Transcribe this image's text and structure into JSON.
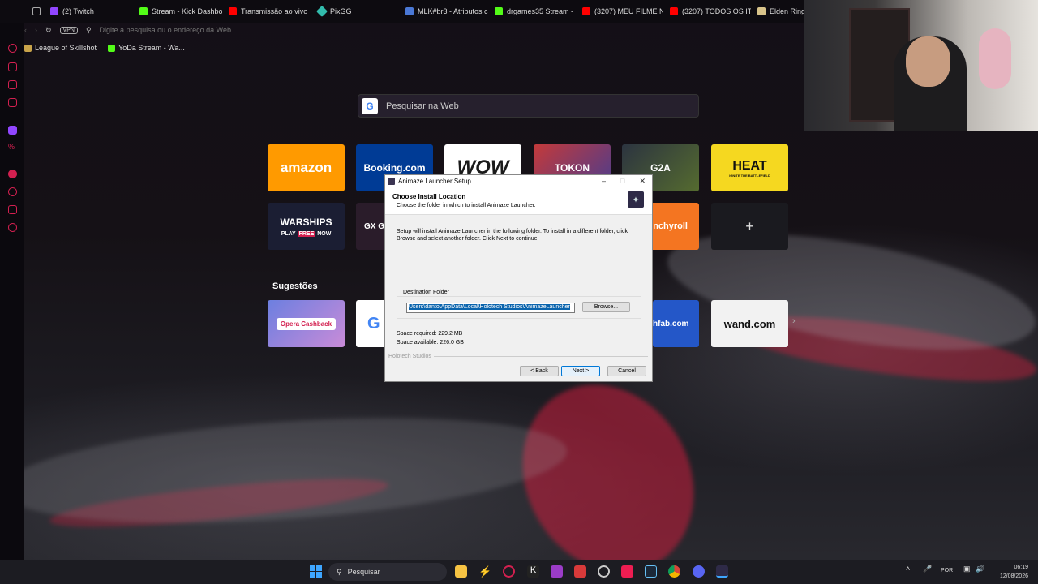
{
  "browser": {
    "tabs": [
      {
        "label": "(2) Twitch",
        "color": "#9146ff"
      },
      {
        "label": "Stream - Kick Dashbo",
        "color": "#53fc18"
      },
      {
        "label": "Transmissão ao vivo",
        "color": "#ff0000"
      },
      {
        "label": "PixGG",
        "color": "#32bcad"
      },
      {
        "label": "MLK#br3 - Atributos c",
        "color": "#4a78d6"
      },
      {
        "label": "drgames35 Stream - ",
        "color": "#53fc18"
      },
      {
        "label": "(3207) MEU FILME N",
        "color": "#ff0000"
      },
      {
        "label": "(3207) TODOS OS IT",
        "color": "#ff0000"
      },
      {
        "label": "Elden Ring M",
        "color": "#d8c38a"
      }
    ],
    "vpn_label": "VPN",
    "address_placeholder": "Digite a pesquisa ou o endereço da Web",
    "bookmarks": [
      {
        "label": "League of Skillshot"
      },
      {
        "label": "YoDa Stream - Wa..."
      }
    ],
    "accent_color": "#d32050"
  },
  "start_page": {
    "search_placeholder": "Pesquisar na Web",
    "speed_dials": [
      {
        "label": "amazon",
        "bg": "#ff9a00",
        "fg": "#ffffff"
      },
      {
        "label": "Booking.com",
        "bg": "#003b95",
        "fg": "#ffffff"
      },
      {
        "label": "WOW",
        "bg": "#ffffff",
        "fg": "#1a1a1a"
      },
      {
        "label": "TOKON",
        "bg": "#4a3c8e",
        "fg": "#ffffff"
      },
      {
        "label": "G2A",
        "bg": "#2c3440",
        "fg": "#ffffff"
      },
      {
        "label": "HEAT",
        "bg": "#f5d820",
        "fg": "#111111"
      },
      {
        "label": "WARSHIPS",
        "bg": "#1b1e33",
        "fg": "#ffffff"
      },
      {
        "label": "GX GA",
        "bg": "#2a1c2a",
        "fg": "#ffffff"
      },
      {
        "label": "nchyroll",
        "bg": "#f47521",
        "fg": "#ffffff"
      },
      {
        "label": "+",
        "bg": "#1a1a1f",
        "fg": "#dddddd"
      }
    ],
    "suggestions_title": "Sugestões",
    "suggestions": [
      {
        "label": "Opera Cashback",
        "bg": "#7a5ad8",
        "fg": "#ffffff"
      },
      {
        "label": "G",
        "bg": "#ffffff",
        "fg": "#4285f4"
      },
      {
        "label": "hfab.com",
        "bg": "#2457c8",
        "fg": "#ffffff"
      },
      {
        "label": "wand.com",
        "bg": "#f2f2f2",
        "fg": "#111111"
      }
    ],
    "warships_play": "PLAY",
    "warships_free": "FREE",
    "warships_now": "NOW",
    "heat_tagline": "IGNITE THE BATTLEFIELD"
  },
  "installer": {
    "window_title": "Animaze Launcher Setup",
    "header_title": "Choose Install Location",
    "header_subtitle": "Choose the folder in which to install Animaze Launcher.",
    "body_text": "Setup will install Animaze Launcher in the following folder. To install in a different folder, click Browse and select another folder. Click Next to continue.",
    "dest_group_label": "Destination Folder",
    "dest_path": "Users\\danto\\AppData\\Local\\Holotech Studios\\AnimazeLauncher",
    "browse_label": "Browse...",
    "space_required": "Space required: 229.2 MB",
    "space_available": "Space available: 226.0 GB",
    "brand": "Holotech Studios",
    "back_label": "< Back",
    "next_label": "Next >",
    "cancel_label": "Cancel"
  },
  "taskbar": {
    "search_placeholder": "Pesquisar",
    "language": "POR",
    "time": "06:19",
    "date": "12/08/2026"
  }
}
